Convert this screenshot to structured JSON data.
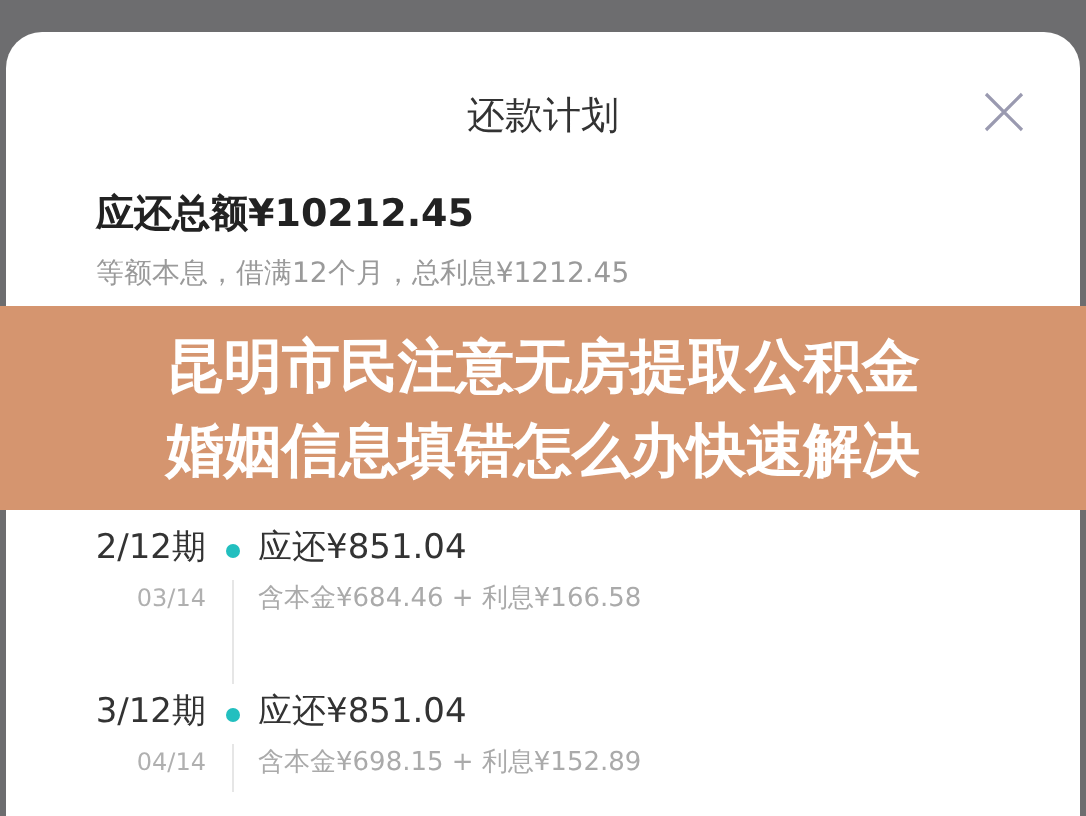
{
  "sheet": {
    "title": "还款计划"
  },
  "summary": {
    "total": "应还总额¥10212.45",
    "detail": "等额本息，借满12个月，总利息¥1212.45"
  },
  "installments": [
    {
      "period": "2/12期",
      "date": "03/14",
      "amount": "应还¥851.04",
      "breakdown": "含本金¥684.46 + 利息¥166.58"
    },
    {
      "period": "3/12期",
      "date": "04/14",
      "amount": "应还¥851.04",
      "breakdown": "含本金¥698.15 + 利息¥152.89"
    }
  ],
  "banner": {
    "lines": [
      "昆明市民注意无房提取公积金",
      "婚姻信息填错怎么办快速解决"
    ]
  }
}
